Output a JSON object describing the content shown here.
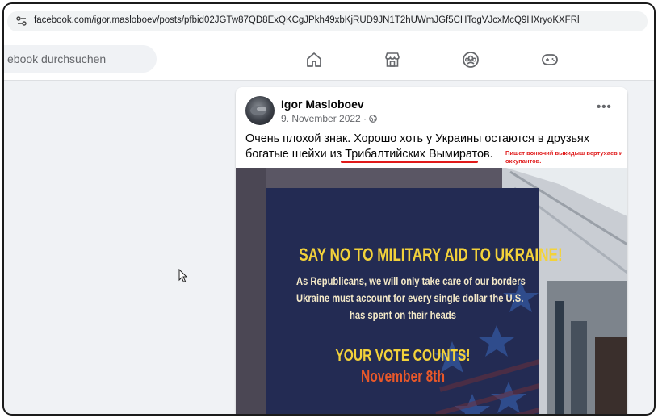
{
  "browser": {
    "url": "facebook.com/igor.masloboev/posts/pfbid02JGTw87QD8ExQKCgJPkh49xbKjRUD9JN1T2hUWmJGf5CHTogVJcxMcQ9HXryoKXFRl",
    "url_icon": "site-settings-icon"
  },
  "navbar": {
    "search_placeholder": "ebook durchsuchen",
    "icons": [
      "home-icon",
      "marketplace-icon",
      "groups-icon",
      "gaming-icon"
    ]
  },
  "post": {
    "author": "Igor Masloboev",
    "date": "9. November 2022 ·",
    "privacy_icon": "globe-icon",
    "more_label": "•••",
    "text_before": "Очень плохой знак. Хорошо хоть у Украины остаются в друзьях богатые шейхи из ",
    "text_highlight": "Трибалтийских Вымиратов",
    "text_after": ".",
    "annotation": "Пишет вонючий выкидыш вертухаев и оккупантов.",
    "annotation_color": "#e01a1a"
  },
  "image": {
    "headline": "SAY NO TO MILITARY AID TO UKRAINE!",
    "body_lines": [
      "As Republicans, we will only take care of our borders",
      "Ukraine must account for every single dollar the U.S.",
      "has spent on their heads"
    ],
    "vote": "YOUR VOTE COUNTS!",
    "date": "November 8th"
  }
}
